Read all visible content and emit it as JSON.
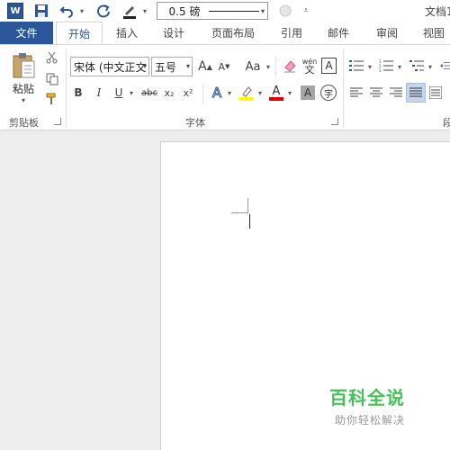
{
  "qat": {
    "app_icon_letter": "W",
    "line_weight": "0.5 磅",
    "doc_title": "文档1"
  },
  "tabs": {
    "file": "文件",
    "items": [
      "开始",
      "插入",
      "设计",
      "页面布局",
      "引用",
      "邮件",
      "审阅",
      "视图"
    ]
  },
  "ribbon": {
    "clipboard": {
      "paste_label": "粘贴",
      "group_label": "剪贴板"
    },
    "font": {
      "font_name": "宋体 (中文正文",
      "font_size": "五号",
      "grow_label": "A",
      "shrink_label": "A",
      "case_label": "Aa",
      "phonetic_top": "wén",
      "phonetic_bottom": "文",
      "border_char_label": "A",
      "bold_label": "B",
      "italic_label": "I",
      "underline_label": "U",
      "strike_label": "abc",
      "subscript_label": "x₂",
      "superscript_label": "x²",
      "effects_label": "A",
      "color_label": "A",
      "shading_label": "A",
      "enclose_label": "字",
      "group_label": "字体",
      "highlight_color": "#ffff00",
      "font_color": "#e00000"
    },
    "paragraph": {
      "group_label": "段"
    }
  },
  "watermark": {
    "title": "百科全说",
    "subtitle": "助你轻松解决"
  },
  "colors": {
    "accent": "#2b579a",
    "watermark": "#47c05a"
  }
}
